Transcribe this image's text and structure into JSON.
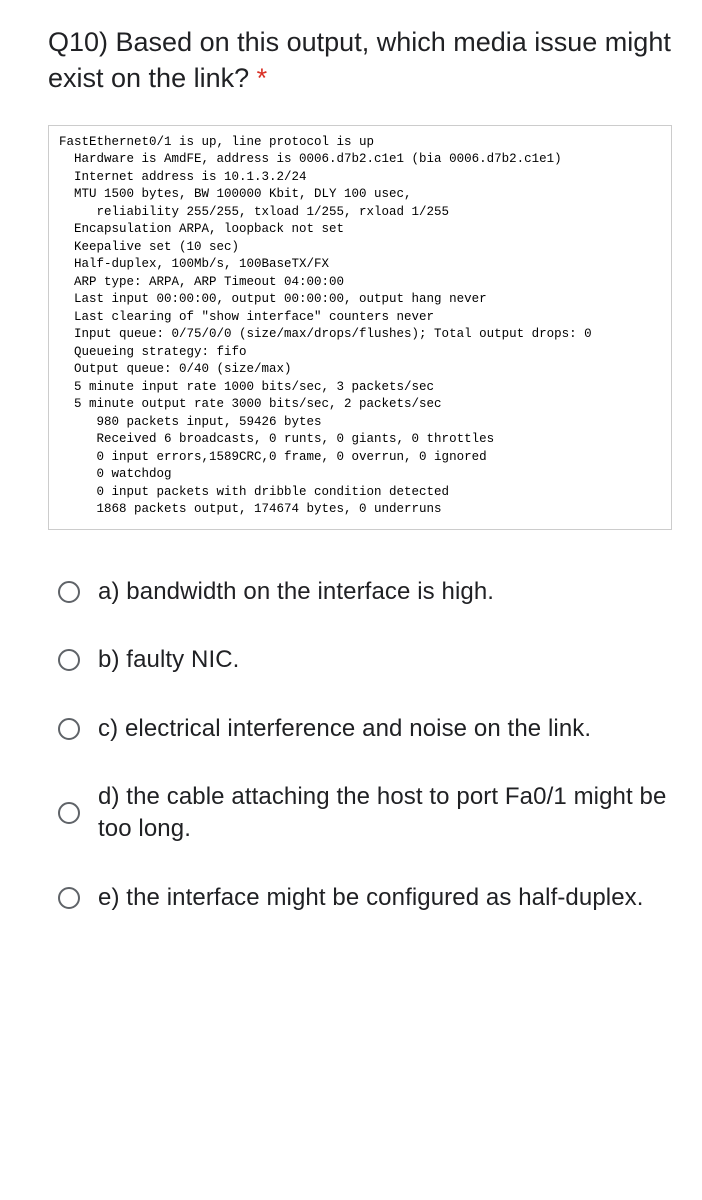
{
  "question": {
    "label": "Q10) Based on this output, which media issue might exist on the link?",
    "required_mark": "*"
  },
  "cli_output": "FastEthernet0/1 is up, line protocol is up\n  Hardware is AmdFE, address is 0006.d7b2.c1e1 (bia 0006.d7b2.c1e1)\n  Internet address is 10.1.3.2/24\n  MTU 1500 bytes, BW 100000 Kbit, DLY 100 usec,\n     reliability 255/255, txload 1/255, rxload 1/255\n  Encapsulation ARPA, loopback not set\n  Keepalive set (10 sec)\n  Half-duplex, 100Mb/s, 100BaseTX/FX\n  ARP type: ARPA, ARP Timeout 04:00:00\n  Last input 00:00:00, output 00:00:00, output hang never\n  Last clearing of \"show interface\" counters never\n  Input queue: 0/75/0/0 (size/max/drops/flushes); Total output drops: 0\n  Queueing strategy: fifo\n  Output queue: 0/40 (size/max)\n  5 minute input rate 1000 bits/sec, 3 packets/sec\n  5 minute output rate 3000 bits/sec, 2 packets/sec\n     980 packets input, 59426 bytes\n     Received 6 broadcasts, 0 runts, 0 giants, 0 throttles\n     0 input errors,1589CRC,0 frame, 0 overrun, 0 ignored\n     0 watchdog\n     0 input packets with dribble condition detected\n     1868 packets output, 174674 bytes, 0 underruns",
  "options": {
    "a": "a) bandwidth on the interface is high.",
    "b": "b) faulty NIC.",
    "c": "c) electrical interference and noise on the link.",
    "d": "d) the cable attaching the host to port Fa0/1 might be too long.",
    "e": "e) the interface might be configured as half-duplex."
  }
}
